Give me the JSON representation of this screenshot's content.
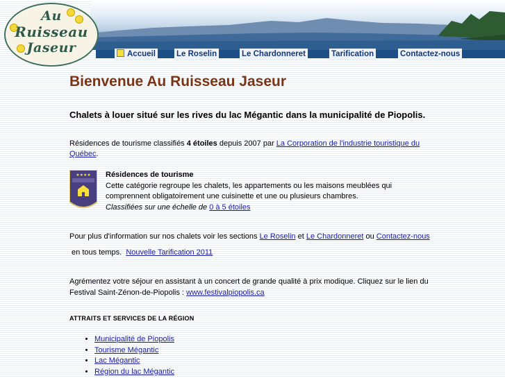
{
  "logo": {
    "line1": "Au",
    "line2": "Ruisseau",
    "line3": "Jaseur"
  },
  "nav": {
    "home": "Accueil",
    "roselin": "Le Roselin",
    "chardonneret": "Le Chardonneret",
    "tarification": "Tarification",
    "contact": "Contactez-nous"
  },
  "colors": {
    "heading": "#7a3414",
    "nav_bar": "#1c4f86",
    "link": "#1a1aa6",
    "accent_yellow": "#f4df3c"
  },
  "main": {
    "title": "Bienvenue Au Ruisseau Jaseur",
    "subtitle": "Chalets à louer situé sur les rives du lac Mégantic dans la municipalité de Piopolis.",
    "p1_before": "Résidences de tourisme classifiés ",
    "p1_bold": "4 étoiles",
    "p1_mid": " depuis 2007 par ",
    "p1_link": "La Corporation de l'industrie touristique du Québec",
    "p1_end": ".",
    "tourism": {
      "title": "Résidences de tourisme",
      "desc": "Cette catégorie regroupe les chalets, les appartements ou les maisons meublées qui comprennent obligatoirement une cuisinette et une ou plusieurs chambres.",
      "scale_prefix": "Classifiées sur une échelle de ",
      "scale_link": "0 à 5 étoiles"
    },
    "p2": {
      "t1": "Pour plus d'information sur nos chalets voir les sections ",
      "l1": "Le Roselin",
      "t2": " et ",
      "l2": "Le Chardonneret",
      "t3": " ou ",
      "l3": "Contactez-nous",
      "t4": " en tous temps.  ",
      "l4": "Nouvelle Tarification 2011"
    },
    "p3": {
      "text": "Agrémentez votre séjour en assistant à un concert de grande qualité à prix modique. Cliquez sur le lien du Festival Saint-Zénon-de-Piopolis : ",
      "link": "www.festivalpiopolis.ca"
    },
    "section_heading": "ATTRAITS ET SERVICES DE LA RÉGION",
    "links": [
      "Municipalité de Piopolis",
      "Tourisme Mégantic",
      "Lac Mégantic",
      "Région du lac Mégantic"
    ]
  }
}
